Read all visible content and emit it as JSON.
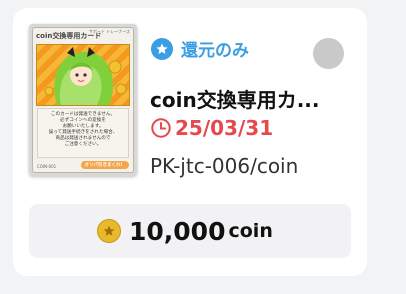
{
  "item": {
    "return_label": "還元のみ",
    "title": "coin交換専用カ...",
    "deadline": "25/03/31",
    "code": "PK-jtc-006/coin",
    "price_amount": "10,000",
    "price_unit": "coin"
  },
  "card_image": {
    "name": "coin交換専用カード",
    "sub_label": "サポート トレーナーズ",
    "body_lines": [
      "このカードは発送できません。",
      "必ずコインへの変換を",
      "お願いいたします。",
      "誤って発送手続きをされた場合、",
      "商品は発送されませんので",
      "ご注意ください。"
    ],
    "code": "COIN-001",
    "button_label": "オリパ引きまくれ！"
  },
  "icons": {
    "return": "star-icon",
    "deadline": "clock-icon",
    "currency": "coin-icon",
    "select": "radio-circle-icon"
  },
  "colors": {
    "accent_blue": "#3b9ee3",
    "deadline_red": "#e5484d",
    "coin_gold": "#e8b92a"
  }
}
